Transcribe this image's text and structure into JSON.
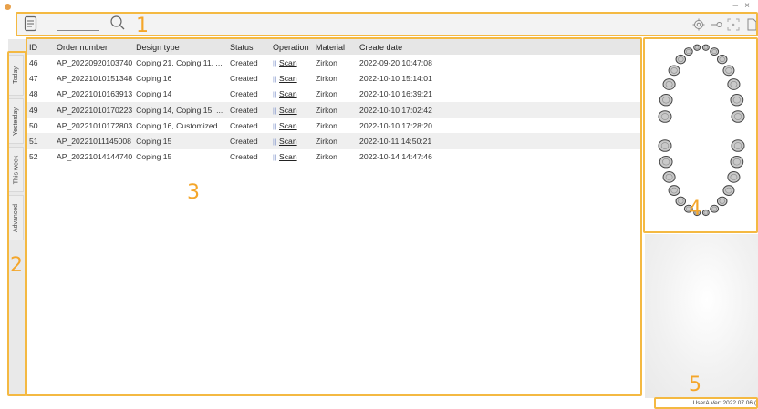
{
  "window": {
    "close_glyph": "×",
    "minimize_glyph": "–"
  },
  "toolbar": {
    "search_value": "",
    "left_icons": [
      "document-icon",
      "search-icon"
    ],
    "right_icons": [
      "settings-icon",
      "key-icon",
      "scan-frame-icon",
      "page-icon"
    ]
  },
  "side_tabs": [
    "Today",
    "Yesterday",
    "This week",
    "Advanced"
  ],
  "table": {
    "columns": [
      "ID",
      "Order number",
      "Design type",
      "Status",
      "Operation",
      "Material",
      "Create date"
    ],
    "rows": [
      {
        "id": "46",
        "order": "AP_20220920103740",
        "design": "Coping 21, Coping 11, ...",
        "status": "Created",
        "op": "Scan",
        "material": "Zirkon",
        "date": "2022-09-20 10:47:08"
      },
      {
        "id": "47",
        "order": "AP_20221010151348",
        "design": "Coping 16",
        "status": "Created",
        "op": "Scan",
        "material": "Zirkon",
        "date": "2022-10-10 15:14:01"
      },
      {
        "id": "48",
        "order": "AP_20221010163913",
        "design": "Coping 14",
        "status": "Created",
        "op": "Scan",
        "material": "Zirkon",
        "date": "2022-10-10 16:39:21"
      },
      {
        "id": "49",
        "order": "AP_20221010170223",
        "design": "Coping 14, Coping 15, ...",
        "status": "Created",
        "op": "Scan",
        "material": "Zirkon",
        "date": "2022-10-10 17:02:42"
      },
      {
        "id": "50",
        "order": "AP_20221010172803",
        "design": "Coping 16, Customized ...",
        "status": "Created",
        "op": "Scan",
        "material": "Zirkon",
        "date": "2022-10-10 17:28:20"
      },
      {
        "id": "51",
        "order": "AP_20221011145008",
        "design": "Coping 15",
        "status": "Created",
        "op": "Scan",
        "material": "Zirkon",
        "date": "2022-10-11 14:50:21"
      },
      {
        "id": "52",
        "order": "AP_20221014144740",
        "design": "Coping 15",
        "status": "Created",
        "op": "Scan",
        "material": "Zirkon",
        "date": "2022-10-14 14:47:46"
      }
    ]
  },
  "annotations": [
    "1",
    "2",
    "3",
    "4",
    "5"
  ],
  "status_bar": {
    "text": "UserA   Ver: 2022.07.06.("
  },
  "colors": {
    "highlight": "#f4b942",
    "annotation_text": "#f4a62a",
    "operation_icon": "#7a8fc8"
  }
}
